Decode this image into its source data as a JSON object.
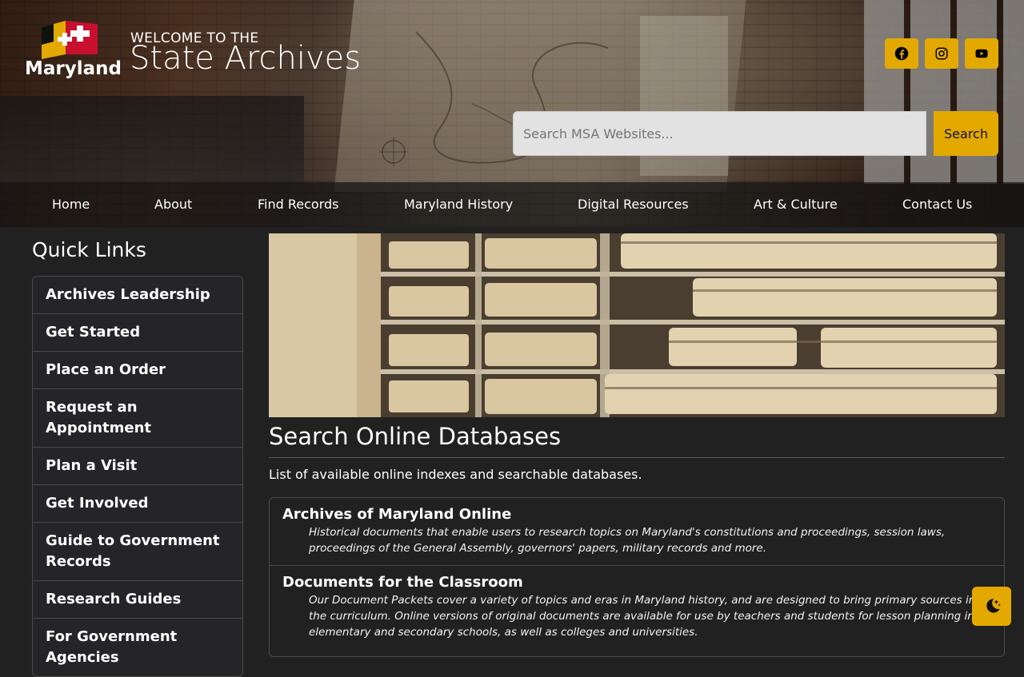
{
  "header": {
    "logo_text": "Maryland",
    "welcome": "WELCOME TO THE",
    "title": "State Archives",
    "social": [
      {
        "icon": "facebook-icon"
      },
      {
        "icon": "instagram-icon"
      },
      {
        "icon": "youtube-icon"
      }
    ],
    "search": {
      "placeholder": "Search MSA Websites...",
      "button": "Search"
    }
  },
  "nav": [
    "Home",
    "About",
    "Find Records",
    "Maryland History",
    "Digital Resources",
    "Art & Culture",
    "Contact Us"
  ],
  "sidebar": {
    "title": "Quick Links",
    "items": [
      "Archives Leadership",
      "Get Started",
      "Place an Order",
      "Request an Appointment",
      "Plan a Visit",
      "Get Involved",
      "Guide to Government Records",
      "Research Guides",
      "For Government Agencies"
    ]
  },
  "main": {
    "title": "Search Online Databases",
    "description": "List of available online indexes and searchable databases.",
    "databases": [
      {
        "name": "Archives of Maryland Online",
        "description": "Historical documents that enable users to research topics on Maryland's constitutions and proceedings, session laws, proceedings of the General Assembly, governors' papers, military records and more."
      },
      {
        "name": "Documents for the Classroom",
        "description": "Our Document Packets cover a variety of topics and eras in Maryland history, and are designed to bring primary sources into the curriculum. Online versions of original documents are available for use by teachers and students for lesson planning in elementary and secondary schools, as well as colleges and universities."
      }
    ]
  },
  "colors": {
    "accent": "#e3a900",
    "background": "#212121",
    "nav_bg": "#141414"
  },
  "theme_toggle": {
    "icon": "moon-stars-icon"
  }
}
